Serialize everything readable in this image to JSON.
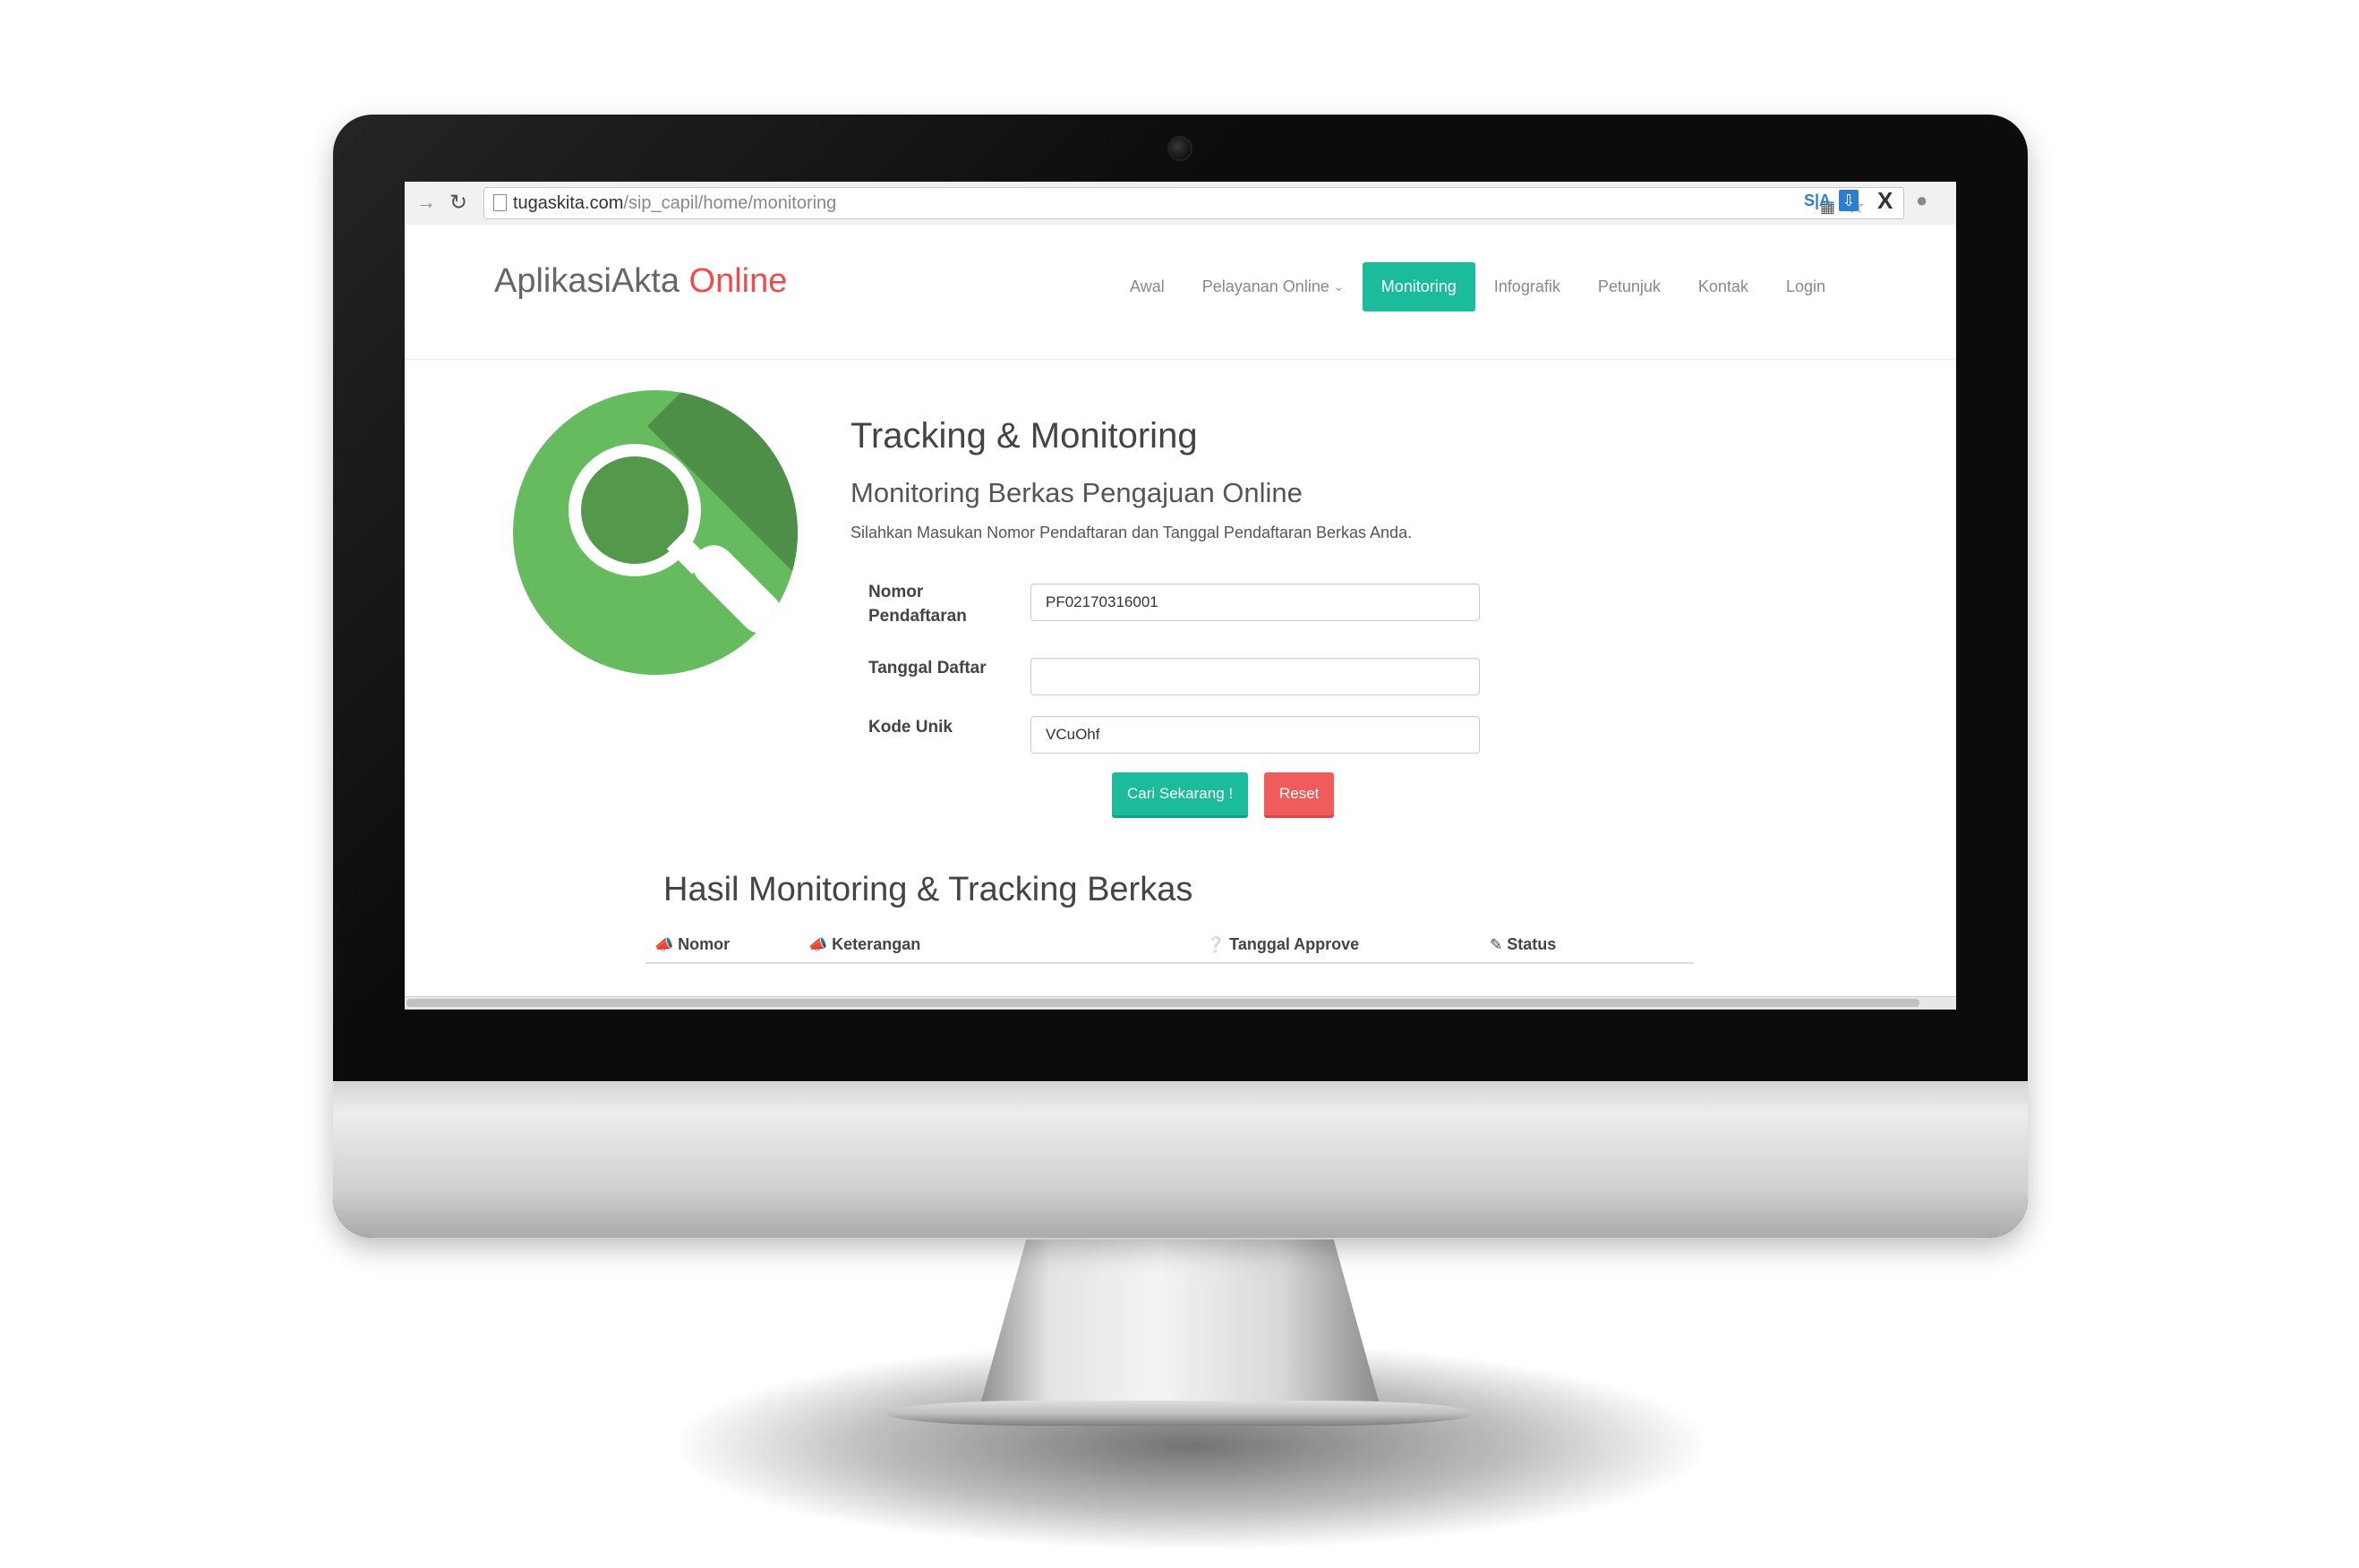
{
  "browser": {
    "url_host": "tugaskita.com",
    "url_path": "/sip_capil/home/monitoring",
    "extension_sa_label": "S|A",
    "extension_x_label": "X"
  },
  "site": {
    "brand_main": "AplikasiAkta",
    "brand_accent": "Online",
    "accent_color": "#f04b4c",
    "primary_color": "#1abc9c",
    "danger_color": "#f05b5b",
    "nav": {
      "awal": "Awal",
      "pelayanan": "Pelayanan Online",
      "monitoring": "Monitoring",
      "infografik": "Infografik",
      "petunjuk": "Petunjuk",
      "kontak": "Kontak",
      "login": "Login"
    },
    "active_nav": "Monitoring"
  },
  "tracking": {
    "title": "Tracking & Monitoring",
    "subtitle": "Monitoring Berkas Pengajuan Online",
    "description": "Silahkan Masukan Nomor Pendaftaran dan Tanggal Pendaftaran Berkas Anda.",
    "icon": "magnifier-icon"
  },
  "form": {
    "nomor_label_1": "Nomor",
    "nomor_label_2": "Pendaftaran",
    "nomor_value": "PF02170316001",
    "tanggal_label": "Tanggal Daftar",
    "tanggal_value": "",
    "kode_label": "Kode Unik",
    "kode_value": "VCuOhf",
    "submit_label": "Cari Sekarang !",
    "reset_label": "Reset"
  },
  "results": {
    "title": "Hasil Monitoring & Tracking Berkas",
    "columns": {
      "nomor": "Nomor",
      "keterangan": "Keterangan",
      "tanggal_approve": "Tanggal Approve",
      "status": "Status"
    }
  }
}
